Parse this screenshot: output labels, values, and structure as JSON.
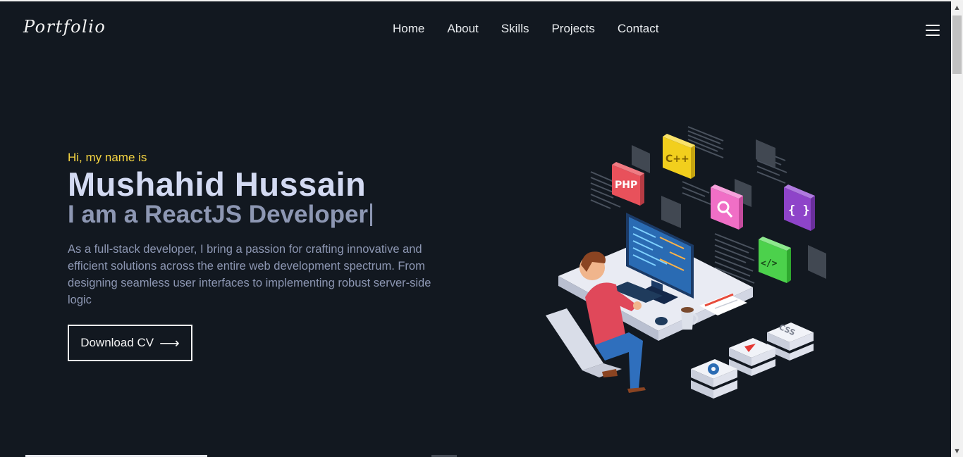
{
  "header": {
    "logo": "Portfolio",
    "nav": [
      "Home",
      "About",
      "Skills",
      "Projects",
      "Contact"
    ]
  },
  "hero": {
    "greeting": "Hi, my name is",
    "name": "Mushahid Hussain",
    "role": "I am a ReactJS Developer",
    "description": "As a full-stack developer, I bring a passion for crafting innovative and efficient solutions across the entire web development spectrum. From designing seamless user interfaces to implementing robust server-side logic",
    "cv_button": "Download CV",
    "cv_icon": "arrow-right-icon"
  },
  "illustration": {
    "badges": [
      "PHP",
      "C++",
      "{ }",
      "</>",
      "CSS"
    ]
  },
  "colors": {
    "background": "#121820",
    "accent_yellow": "#f5d442",
    "name_color": "#d3daf2",
    "muted_text": "#8d97b3"
  }
}
